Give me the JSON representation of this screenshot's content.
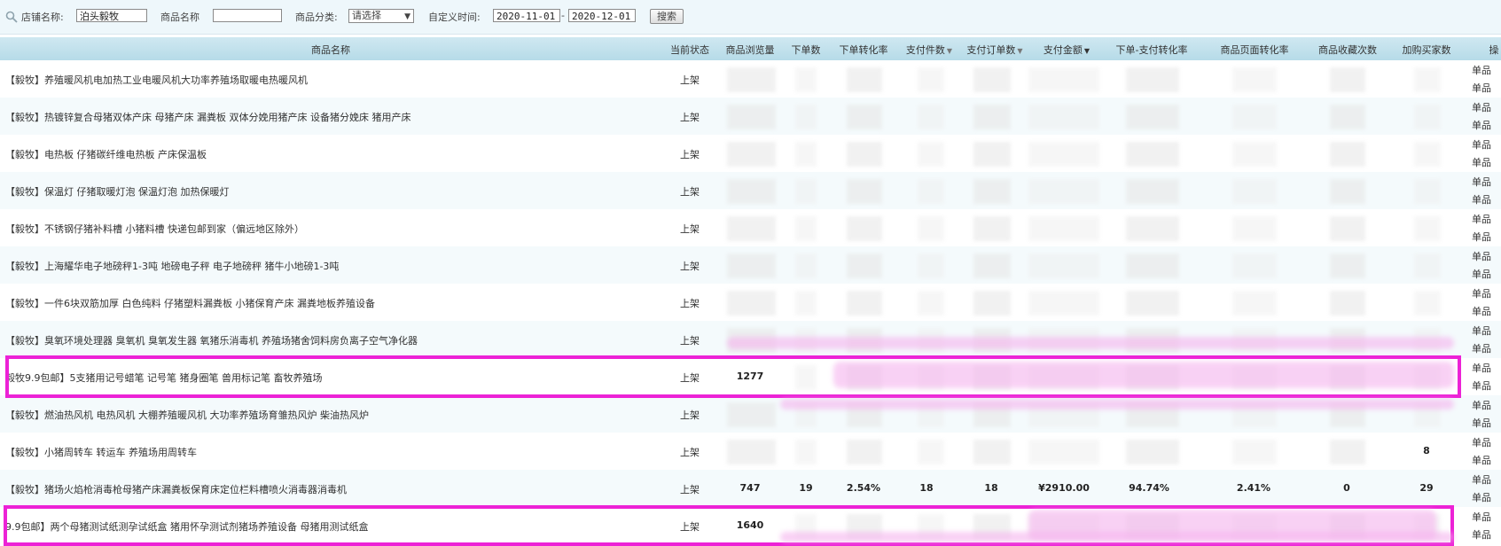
{
  "filters": {
    "shop_label": "店铺名称:",
    "shop_value": "泊头毅牧",
    "product_label": "商品名称",
    "product_value": "",
    "category_label": "商品分类:",
    "category_value": "请选择",
    "time_label": "自定义时间:",
    "date_from": "2020-11-01",
    "date_sep": "-",
    "date_to": "2020-12-01",
    "search_button": "搜索"
  },
  "columns": {
    "name": "商品名称",
    "status": "当前状态",
    "views": "商品浏览量",
    "orders": "下单数",
    "order_rate": "下单转化率",
    "paid_items": "支付件数",
    "paid_orders": "支付订单数",
    "paid_amount": "支付金额",
    "order_pay_rate": "下单-支付转化率",
    "page_rate": "商品页面转化率",
    "favorites": "商品收藏次数",
    "cart_buyers": "加购买家数",
    "ops": "操"
  },
  "ops_labels": [
    "单品",
    "单品"
  ],
  "rows": [
    {
      "name": "【毅牧】养殖暖风机电加热工业电暖风机大功率养殖场取暖电热暖风机",
      "status": "上架"
    },
    {
      "name": "【毅牧】热镀锌复合母猪双体产床 母猪产床 漏粪板 双体分娩用猪产床 设备猪分娩床 猪用产床",
      "status": "上架"
    },
    {
      "name": "【毅牧】电热板 仔猪碳纤维电热板 产床保温板",
      "status": "上架"
    },
    {
      "name": "【毅牧】保温灯 仔猪取暖灯泡 保温灯泡 加热保暖灯",
      "status": "上架"
    },
    {
      "name": "【毅牧】不锈钢仔猪补料槽 小猪料槽 快递包邮到家（偏远地区除外）",
      "status": "上架"
    },
    {
      "name": "【毅牧】上海耀华电子地磅秤1-3吨 地磅电子秤 电子地磅秤 猪牛小地磅1-3吨",
      "status": "上架"
    },
    {
      "name": "【毅牧】一件6块双筋加厚 白色纯料 仔猪塑料漏粪板 小猪保育产床 漏粪地板养殖设备",
      "status": "上架"
    },
    {
      "name": "【毅牧】臭氧环境处理器 臭氧机 臭氧发生器 氧猪乐消毒机 养殖场猪舍饲料房负离子空气净化器",
      "status": "上架"
    },
    {
      "name": "毅牧9.9包邮】5支猪用记号蜡笔 记号笔 猪身圈笔 兽用标记笔 畜牧养殖场",
      "status": "上架",
      "views": "1277"
    },
    {
      "name": "【毅牧】燃油热风机 电热风机 大棚养殖暖风机 大功率养殖场育雏热风炉 柴油热风炉",
      "status": "上架"
    },
    {
      "name": "【毅牧】小猪周转车 转运车 养殖场用周转车",
      "status": "上架",
      "cart_buyers": "8"
    },
    {
      "name": "【毅牧】猪场火焰枪消毒枪母猪产床漏粪板保育床定位栏料槽喷火消毒器消毒机",
      "status": "上架",
      "views": "747",
      "orders": "19",
      "order_rate": "2.54%",
      "paid_items": "18",
      "paid_orders": "18",
      "paid_amount": "¥2910.00",
      "order_pay_rate": "94.74%",
      "page_rate": "2.41%",
      "favorites": "0",
      "cart_buyers": "29"
    },
    {
      "name": "9.9包邮】两个母猪测试纸测孕试纸盒 猪用怀孕测试剂猪场养殖设备 母猪用测试纸盒",
      "status": "上架",
      "views": "1640"
    }
  ],
  "colors": {
    "highlight": "#ec22d6",
    "header": "#b6dbe8"
  }
}
